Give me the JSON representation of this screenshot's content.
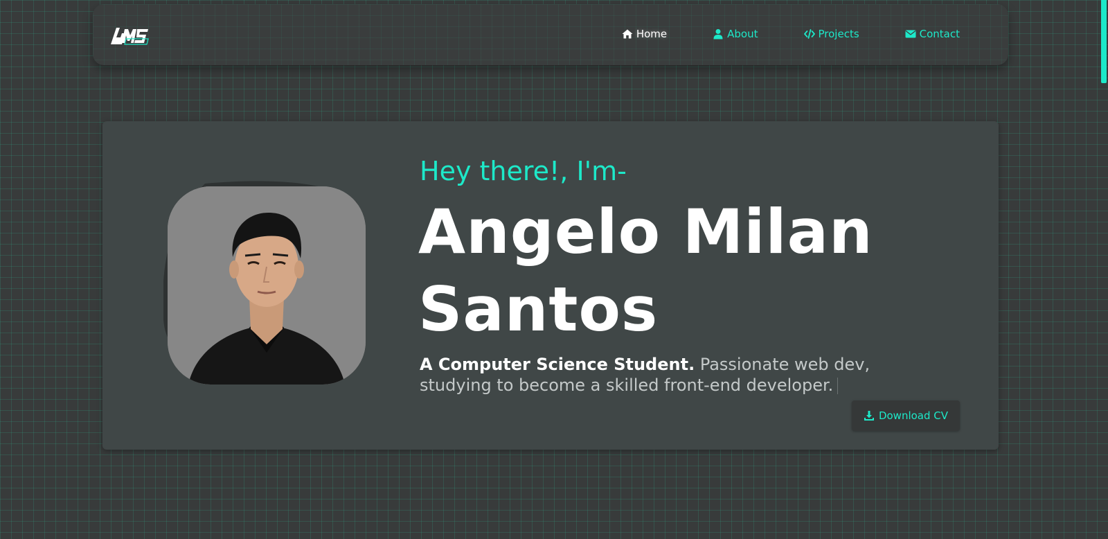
{
  "nav": {
    "logo_text": "AMS",
    "links": [
      {
        "label": "Home",
        "icon": "home-icon",
        "active": true
      },
      {
        "label": "About",
        "icon": "user-icon",
        "active": false
      },
      {
        "label": "Projects",
        "icon": "code-icon",
        "active": false
      },
      {
        "label": "Contact",
        "icon": "envelope-icon",
        "active": false
      }
    ]
  },
  "hero": {
    "greeting": "Hey there!, I'm-",
    "name_line1": "Angelo Milan",
    "name_line2": "Santos",
    "tagline_bold": "A Computer Science Student.",
    "tagline_rest": " Passionate web dev, studying to become a skilled front-end developer.",
    "download_label": "Download CV",
    "download_icon": "download-icon"
  },
  "colors": {
    "accent": "#1de9c9",
    "background": "#383b3b",
    "card": "#404747",
    "text": "#ffffff"
  }
}
